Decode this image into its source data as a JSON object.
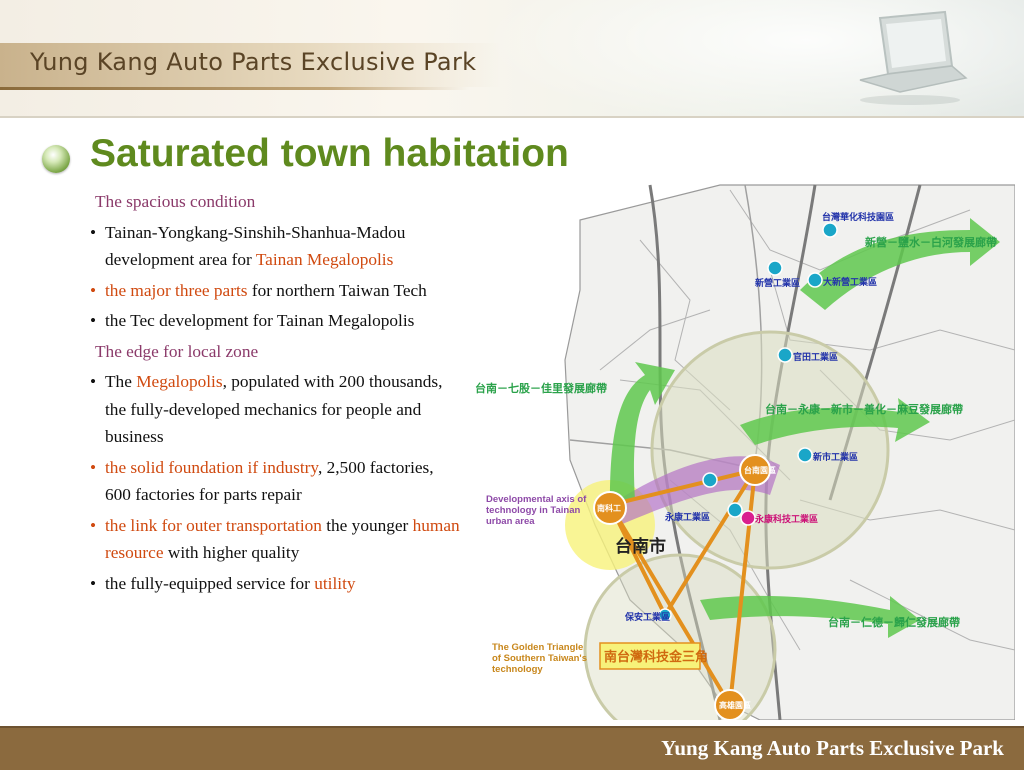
{
  "header": {
    "brand": "Yung Kang Auto Parts Exclusive Park"
  },
  "slide": {
    "title": "Saturated town habitation",
    "sections": [
      {
        "heading": "The spacious condition",
        "items": [
          {
            "parts": [
              {
                "t": "Tainan-Yongkang-Sinshih-Shanhua-Madou development area for "
              },
              {
                "t": "Tainan Megalopolis",
                "hl": true
              }
            ]
          },
          {
            "parts": [
              {
                "t": "the major three parts",
                "hl": true
              },
              {
                "t": " for northern Taiwan Tech"
              }
            ],
            "bullet_hl": true
          },
          {
            "parts": [
              {
                "t": "the Tec development for Tainan Megalopolis"
              }
            ]
          }
        ]
      },
      {
        "heading": "The edge for local zone",
        "items": [
          {
            "parts": [
              {
                "t": "The "
              },
              {
                "t": "Megalopolis",
                "hl": true
              },
              {
                "t": ", populated with 200 thousands, the fully-developed mechanics for people and business"
              }
            ]
          },
          {
            "parts": [
              {
                "t": "the solid foundation if industry",
                "hl": true
              },
              {
                "t": ", 2,500 factories, 600 factories for parts repair"
              }
            ],
            "bullet_hl": true
          },
          {
            "parts": [
              {
                "t": "the link for outer transportation",
                "hl": true
              },
              {
                "t": " the younger "
              },
              {
                "t": "human resource",
                "hl": true
              },
              {
                "t": " with higher quality"
              }
            ],
            "bullet_hl": true
          },
          {
            "parts": [
              {
                "t": "the fully-equipped service for "
              },
              {
                "t": "utility",
                "hl": true
              }
            ]
          }
        ]
      }
    ]
  },
  "map": {
    "corridors": [
      "新營－鹽水－白河發展廊帶",
      "台南－七股－佳里發展廊帶",
      "台南－永康－新市－善化－麻豆發展廊帶",
      "台南－仁德－歸仁發展廊帶"
    ],
    "parks": [
      "台灣華化科技園區",
      "新營工業區",
      "大新營工業區",
      "官田工業區",
      "新市工業區",
      "南科工",
      "台南園區",
      "永康工業區",
      "永康科技工業區",
      "保安工業區",
      "高雄園區"
    ],
    "dev_axis": "Developmental axis of technology in Tainan urban area",
    "golden_triangle": "The Golden Triangle of Southern Taiwan's technology",
    "triangle_cn": "南台灣科技金三角",
    "city": "台南市",
    "colors": {
      "arrow": "#5fc84e",
      "halo": "#d9dcc0",
      "axis": "#b06cc6",
      "triangle": "#e3901e",
      "glow": "#f7f27a",
      "corridor_text": "#2aa24a",
      "park_text": "#2233aa"
    }
  },
  "footer": {
    "brand": "Yung Kang Auto Parts Exclusive Park"
  }
}
